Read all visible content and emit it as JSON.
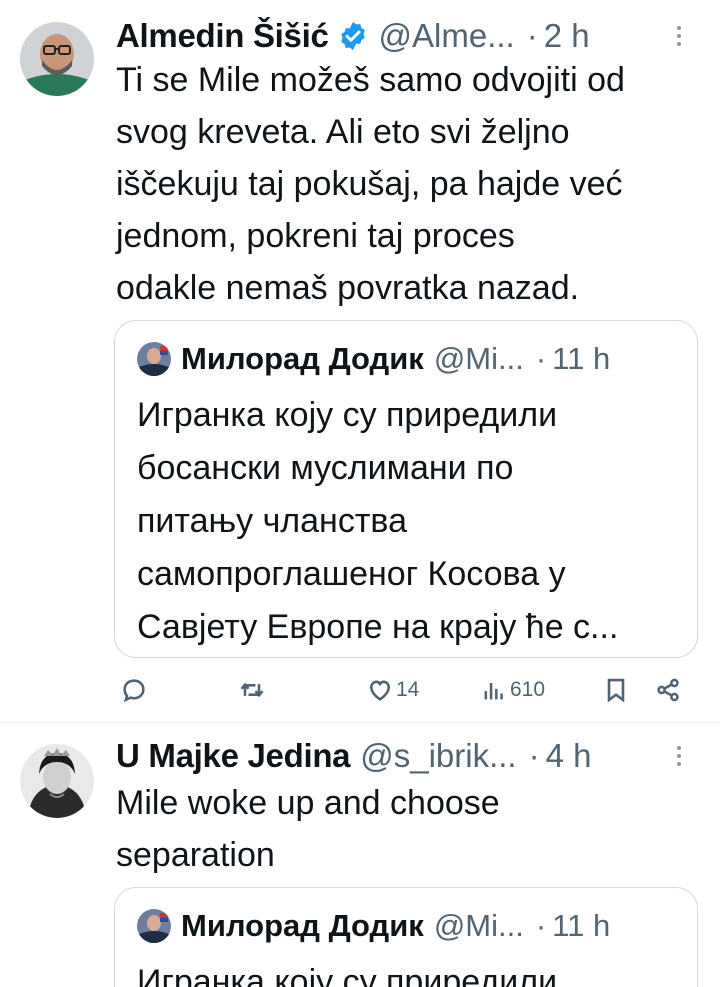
{
  "tweets": [
    {
      "author": {
        "name": "Almedin Šišić",
        "handle": "@Alme...",
        "time": "2 h",
        "verified": true
      },
      "body_lines": [
        "Ti se Mile možeš samo odvojiti od",
        "svog kreveta. Ali eto svi željno",
        "iščekuju taj pokušaj, pa hajde već",
        "jednom, pokreni taj proces",
        "odakle nemaš povratka nazad."
      ],
      "quote": {
        "name": "Милорад Додик",
        "handle": "@Mi...",
        "time": "11 h",
        "lines": [
          "Игранка коју су приредили",
          "босански муслимани по",
          "питању чланства",
          "самопроглашеног Косова у",
          "Савјету Европе на крају ће с..."
        ]
      },
      "actions": {
        "likes": "14",
        "views": "610"
      }
    },
    {
      "author": {
        "name": "U Majke Jedina",
        "handle": "@s_ibrik...",
        "time": "4 h",
        "verified": false
      },
      "body_lines": [
        "Mile woke up and choose",
        "separation"
      ],
      "quote": {
        "name": "Милорад Додик",
        "handle": "@Mi...",
        "time": "11 h",
        "lines": [
          "Игранка коју су приредили"
        ]
      }
    }
  ],
  "separator": "·",
  "colors": {
    "verified": "#1d9bf0",
    "secondary_text": "#536471",
    "border": "#cfd9de"
  },
  "icons": [
    "verified-badge-icon",
    "more-icon",
    "reply-icon",
    "retweet-icon",
    "like-icon",
    "views-icon",
    "bookmark-icon",
    "share-icon"
  ]
}
